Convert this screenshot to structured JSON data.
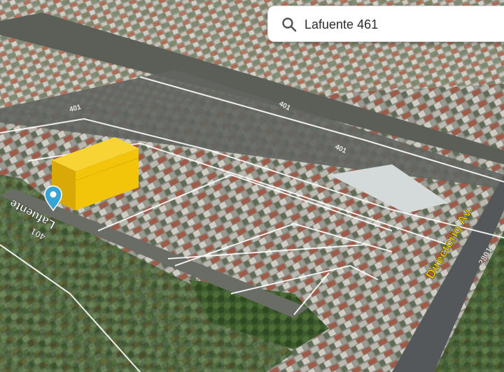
{
  "search": {
    "value": "Lafuente 461"
  },
  "labels": {
    "street_lafuente": "Lafuente",
    "number_lafuente": "401",
    "street_directorio": "Directorio Av.",
    "number_directorio": "2801",
    "street_top": "401",
    "street_mid": "401",
    "street_far": "401"
  },
  "colors": {
    "building_highlight": "#f2c40a",
    "pin": "#38a3d6",
    "avenue_label": "#f5d200"
  },
  "icons": {
    "search": "search-icon",
    "pin": "location-pin-icon"
  }
}
